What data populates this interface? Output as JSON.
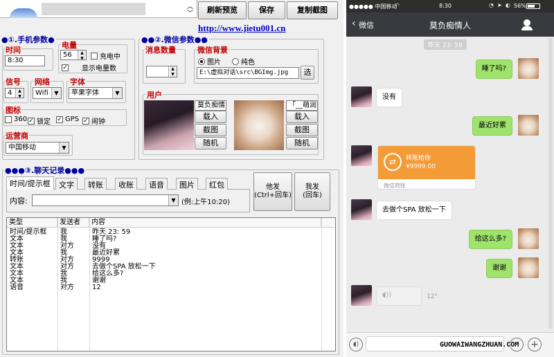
{
  "toolbar": {
    "refresh": "刷新预览",
    "save": "保存",
    "copy": "复制截图",
    "url": "http://www.jietu001.cn"
  },
  "phone_params": {
    "title": "●①.手机参数●",
    "time": {
      "label": "时间",
      "value": "8:30"
    },
    "power": {
      "label": "电量",
      "value": "56",
      "charging": "充电中",
      "show": "显示电量数"
    },
    "signal": {
      "label": "信号",
      "value": "4"
    },
    "network": {
      "label": "网络",
      "value": "Wifi"
    },
    "font": {
      "label": "字体",
      "value": "苹果字体"
    },
    "icons": {
      "label": "图标",
      "items": [
        "360",
        "锁定",
        "GPS",
        "闹钟"
      ]
    },
    "carrier": {
      "label": "运营商",
      "value": "中国移动"
    }
  },
  "wechat_params": {
    "title": "●●②.微信参数●●",
    "unread": {
      "label": "消息数量",
      "value": ""
    },
    "bg": {
      "label": "微信背景",
      "image": "图片",
      "solid": "纯色",
      "path": "E:\\虚拟对话\\src\\BGImg.jpg",
      "pick": "选"
    },
    "users": {
      "label": "用户",
      "self": {
        "name": "莫负痴情",
        "load": "载入",
        "crop": "截图",
        "random": "随机"
      },
      "other": {
        "name": "「__萌润",
        "load": "载入",
        "crop": "截图",
        "random": "随机"
      }
    }
  },
  "chat_records": {
    "title": "●●●③.聊天记录●●●",
    "tabs": [
      "时间/提示框",
      "文字",
      "转账",
      "收账",
      "语音",
      "图片",
      "红包"
    ],
    "content_label": "内容:",
    "hint": "(例:上午10:20)",
    "other_send": "他发\n(Ctrl+回车)",
    "me_send": "我发\n(回车)",
    "columns": [
      "类型",
      "发送者",
      "内容"
    ],
    "rows": [
      [
        "时间/提示框",
        "我",
        "昨天 23: 59"
      ],
      [
        "文本",
        "我",
        "睡了吗?"
      ],
      [
        "文本",
        "对方",
        "没有"
      ],
      [
        "文本",
        "我",
        "最近好累"
      ],
      [
        "转账",
        "对方",
        "9999"
      ],
      [
        "文本",
        "对方",
        "去做个SPA 放松一下"
      ],
      [
        "文本",
        "我",
        "给这么多?"
      ],
      [
        "文本",
        "我",
        "谢谢"
      ],
      [
        "语音",
        "对方",
        "12"
      ]
    ]
  },
  "phone": {
    "status": {
      "carrier": "●●●●● 中国移动",
      "time": "8:30",
      "battery": "56%"
    },
    "nav": {
      "back": "微信",
      "title": "莫负痴情人"
    },
    "timestamp": "昨天 23: 59",
    "messages": [
      {
        "side": "right",
        "text": "睡了吗?"
      },
      {
        "side": "left",
        "text": "没有"
      },
      {
        "side": "right",
        "text": "最近好累"
      },
      {
        "side": "left",
        "text": "去做个SPA 放松一下"
      },
      {
        "side": "right",
        "text": "给这么多?"
      },
      {
        "side": "right",
        "text": "谢谢"
      }
    ],
    "transfer": {
      "title": "转账给你",
      "amount": "¥9999.00",
      "footer": "微信转账"
    },
    "voice": {
      "duration": "12\""
    },
    "watermark": "GUOWAIWANGZHUAN.COM"
  },
  "colors": {
    "group_title": "#0000a0",
    "label_red": "#c00000",
    "wechat_nav": "#393a3f",
    "bubble_green": "#9fe36c",
    "transfer_orange": "#f39b37"
  }
}
